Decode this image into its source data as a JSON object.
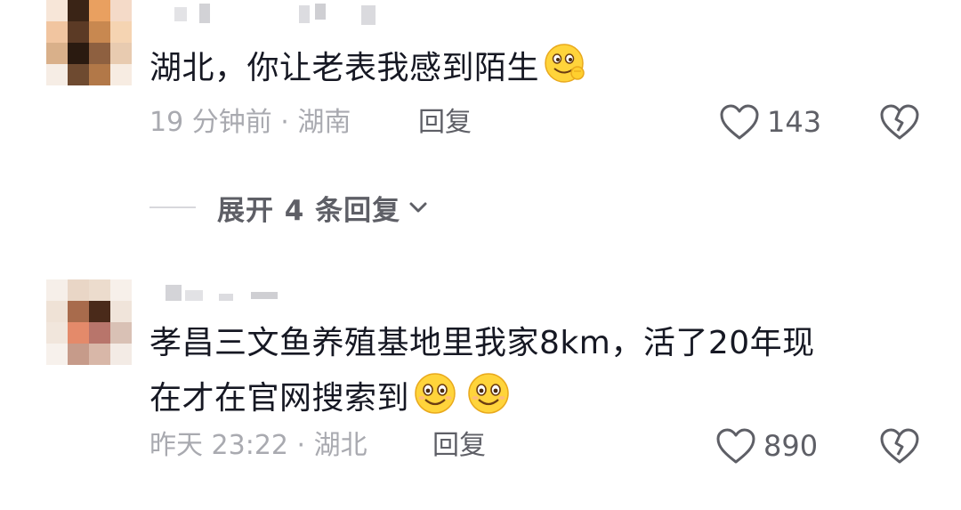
{
  "comments": [
    {
      "text": "湖北，你让老表我感到陌生",
      "time_location": "19 分钟前 · 湖南",
      "reply_label": "回复",
      "likes": "143",
      "emojis": [
        "grinning-wink-emoji"
      ]
    },
    {
      "text_line1": "孝昌三文鱼养殖基地里我家8km，活了20年现",
      "text_line2": "在才在官网搜索到",
      "time_location": "昨天 23:22 · 湖北",
      "reply_label": "回复",
      "likes": "890",
      "emojis": [
        "smile-emoji",
        "smile-emoji"
      ]
    }
  ],
  "expand_replies": {
    "label": "展开 4 条回复"
  },
  "colors": {
    "text": "#161823",
    "meta": "#a9aab0",
    "action": "#5e5f66",
    "emoji_yellow": "#ffd43b"
  }
}
